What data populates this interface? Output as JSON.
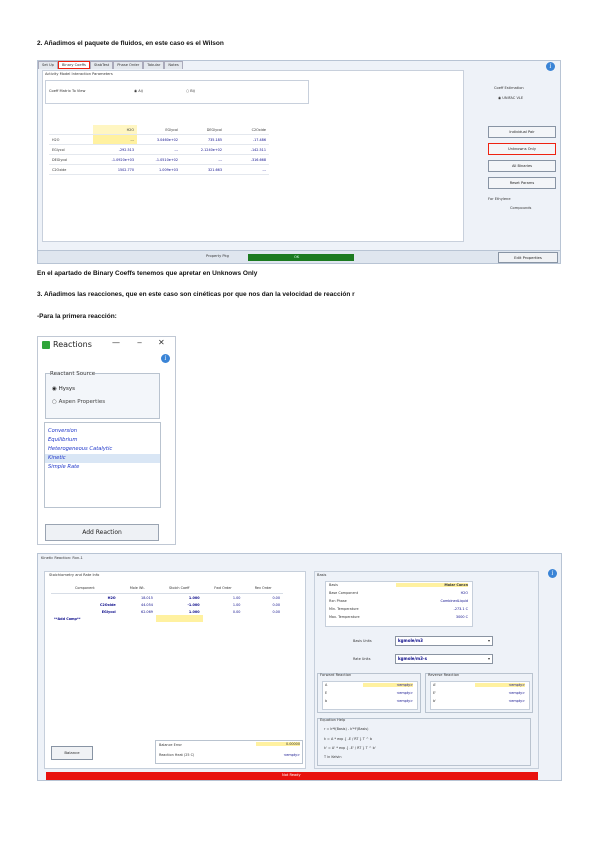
{
  "doc": {
    "heading2": "2. Añadimos el paquete de fluidos, en este caso es el Wilson",
    "binary_note": "En el apartado de Binary Coeffs tenemos que apretar en Unknows Only",
    "heading3": "3. Añadimos las reacciones, que en este caso son cinéticas por que nos dan la velocidad de reacción r",
    "first_reaction": "-Para la primera reacción:"
  },
  "fluid_pkg": {
    "tabs": [
      "Set Up",
      "Binary Coeffs",
      "StabTest",
      "Phase Order",
      "Tabular",
      "Notes"
    ],
    "header": "Activity Model Interaction Parameters",
    "coeff_label": "Coeff Matrix To View",
    "radio_aij": "Aij",
    "radio_bij": "Bij",
    "columns": [
      "",
      "H2O",
      "EGlycol",
      "DEGlycol",
      "C2Oxide"
    ],
    "rows": [
      [
        "H2O",
        "---",
        "3.0460e+02",
        "735.185",
        "-17.486"
      ],
      [
        "EGlycol",
        "-292.513",
        "---",
        "2.1240e+02",
        "-142.511"
      ],
      [
        "DEGlycol",
        "-1.0920e+03",
        "-1.0510e+02",
        "---",
        "-316.668"
      ],
      [
        "C2Oxide",
        "1502.770",
        "1.009e+03",
        "321.663",
        "---"
      ]
    ],
    "estimation_label": "Coeff Estimation",
    "unifac_label": "UNIFAC VLE",
    "buttons": [
      "Individual Pair",
      "Unknowns Only",
      "All Binaries",
      "Reset Params"
    ],
    "for_label": "For Ethylene",
    "component_label": "Compounds",
    "property_pkg_label": "Property Pkg",
    "status_ok": "OK",
    "edit_props": "Edit Properties",
    "colors": {
      "highlight": "#e21a12",
      "ok_bar": "#1b7a20"
    }
  },
  "reactions_window": {
    "title": "Reactions",
    "reactant_source": "Reactant Source",
    "options": [
      "Hysys",
      "Aspen Properties"
    ],
    "selected_option": "Hysys",
    "reaction_types": [
      "Conversion",
      "Equilibrium",
      "Heterogeneous Catalytic",
      "Kinetic",
      "Simple Rate"
    ],
    "selected_type": "Kinetic",
    "add_reaction": "Add Reaction",
    "controls": [
      "—",
      "‒",
      "✕"
    ]
  },
  "kinetic_reaction": {
    "title": "Kinetic Reaction: Rxn-1",
    "stoich_title": "Stoichiometry and Rate Info",
    "columns": [
      "Component",
      "Mole Wt.",
      "Stoich Coeff",
      "Fwd Order",
      "Rev Order"
    ],
    "rows": [
      [
        "H2O",
        "18.015",
        "1.000",
        "1.00",
        "0.00"
      ],
      [
        "C2Oxide",
        "44.054",
        "-1.000",
        "1.00",
        "0.00"
      ],
      [
        "EGlycol",
        "62.069",
        "1.000",
        "0.00",
        "0.00"
      ]
    ],
    "add_comp": "**Add Comp**",
    "balance_btn": "Balance",
    "balance_error_label": "Balance Error",
    "balance_error": "0.00000",
    "heat_label": "Reaction Heat (25 C)",
    "heat_value": "<empty>",
    "basis_title": "Basis",
    "basis_fields": [
      [
        "Basis",
        "Molar Concn"
      ],
      [
        "Base Component",
        "H2O"
      ],
      [
        "Rxn Phase",
        "CombinedLiquid"
      ],
      [
        "Min. Temperature",
        "-273.1 C"
      ],
      [
        "Max. Temperature",
        "3000 C"
      ]
    ],
    "basis_units_label": "Basis Units",
    "basis_units": "kgmole/m3",
    "rate_units_label": "Rate Units",
    "rate_units": "kgmole/m3-s",
    "forward_title": "Forward Reaction",
    "reverse_title": "Reverse Reaction",
    "forward_params": [
      [
        "A",
        "<empty>"
      ],
      [
        "E",
        "<empty>"
      ],
      [
        "b",
        "<empty>"
      ]
    ],
    "reverse_params": [
      [
        "A'",
        "<empty>"
      ],
      [
        "E'",
        "<empty>"
      ],
      [
        "b'",
        "<empty>"
      ]
    ],
    "equation_title": "Equation Help",
    "equations": [
      "r = k*f(Basis) - k'*f'(Basis)",
      "k = A * exp { -E / RT } T ^ b",
      "k' = A' * exp { -E' / RT } T ^ b'",
      "T in Kelvin"
    ],
    "status": "Not Ready",
    "status_color": "#e8120e"
  }
}
